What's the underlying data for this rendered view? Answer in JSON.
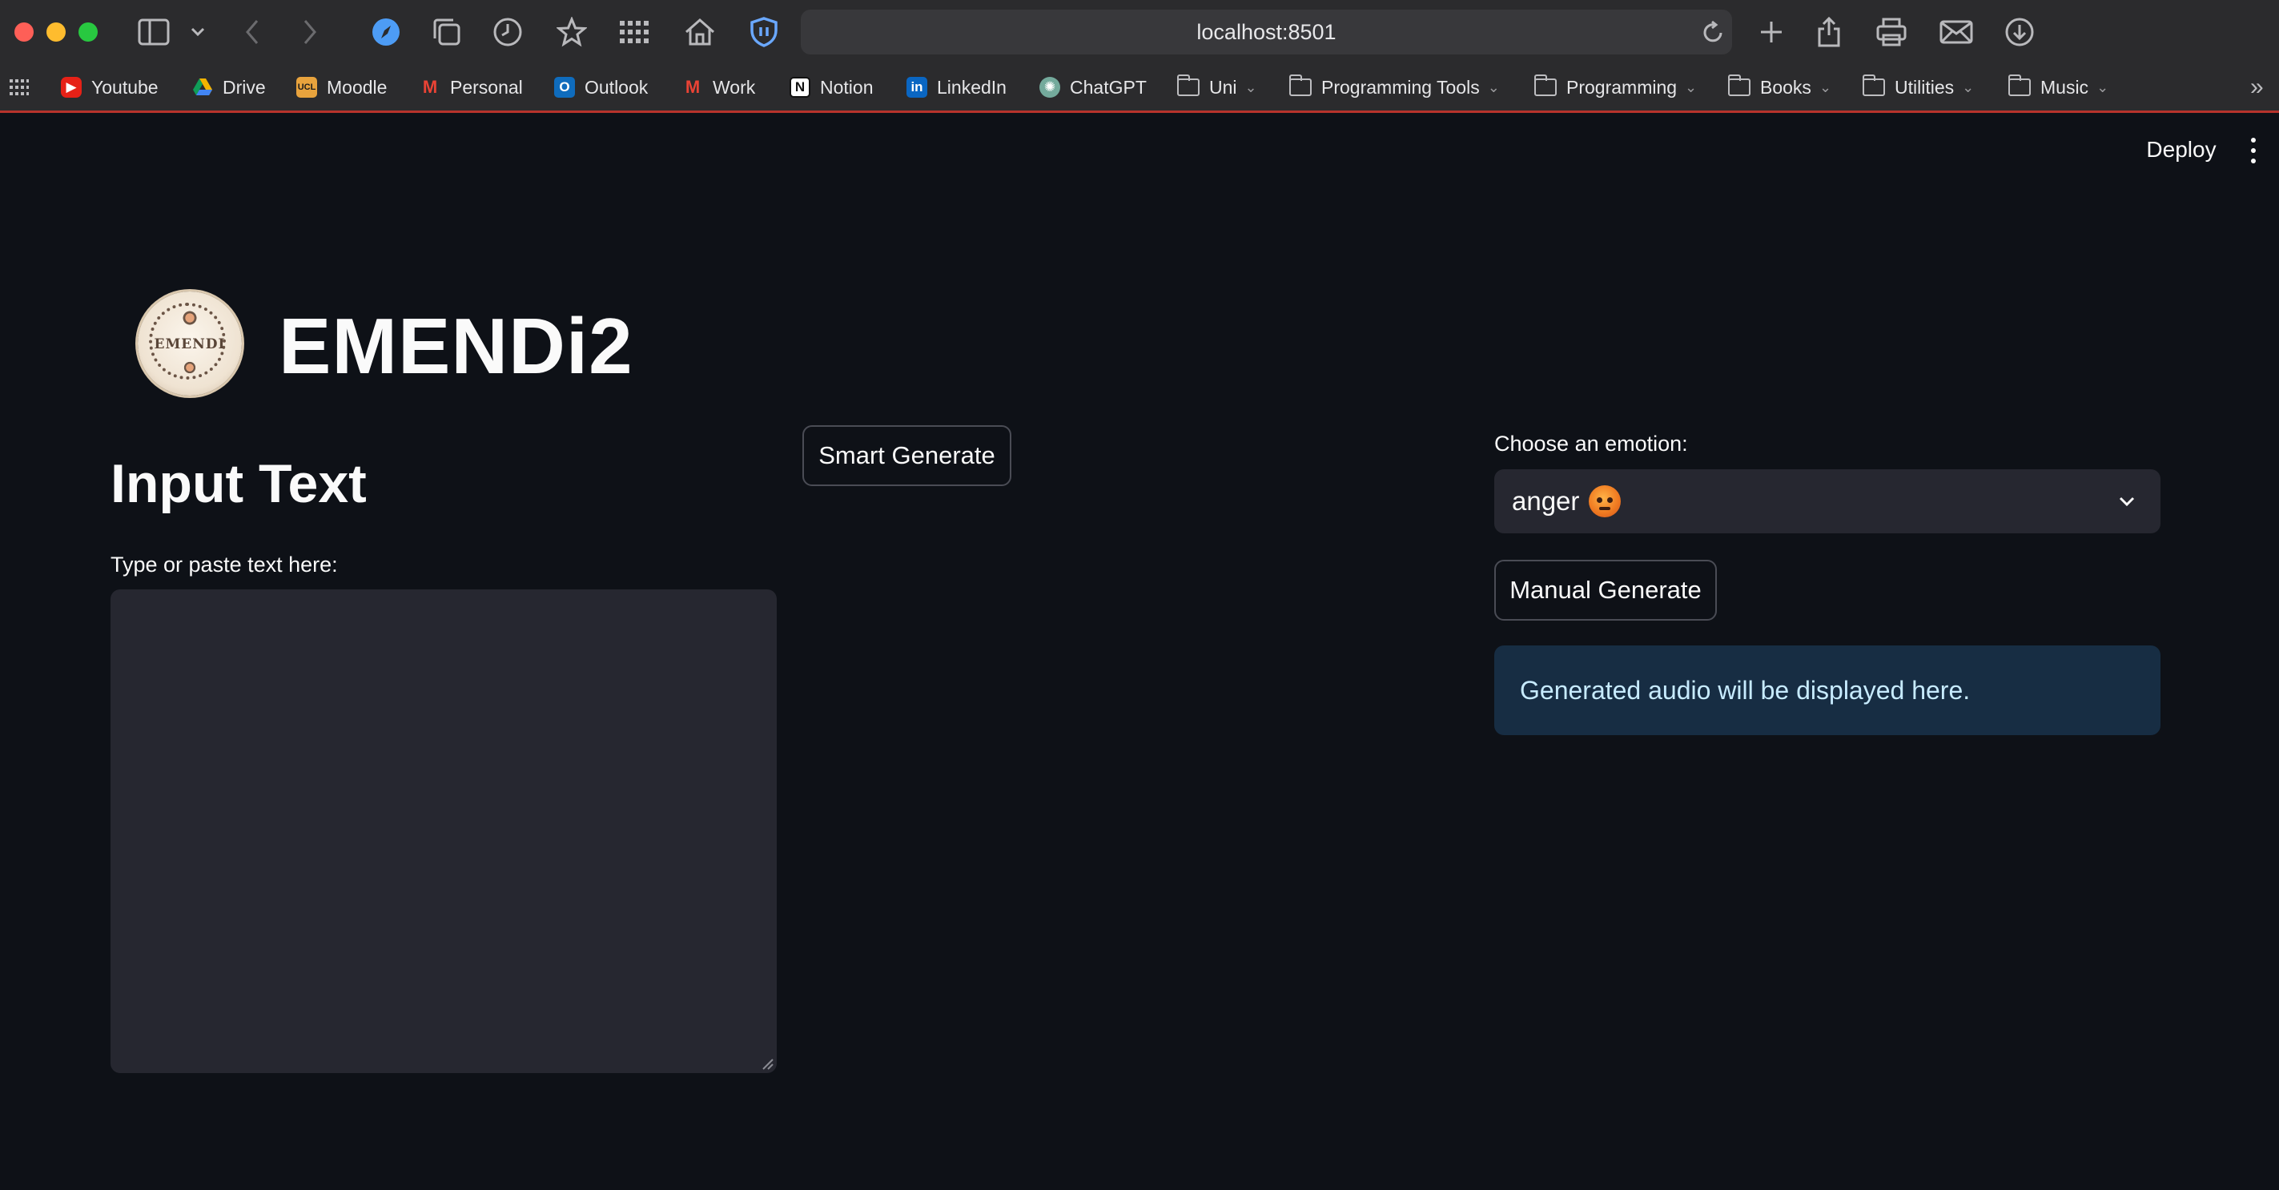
{
  "browser": {
    "url": "localhost:8501",
    "bookmarks": [
      {
        "label": "Youtube",
        "icon": "youtube-icon"
      },
      {
        "label": "Drive",
        "icon": "drive-icon"
      },
      {
        "label": "Moodle",
        "icon": "moodle-icon"
      },
      {
        "label": "Personal",
        "icon": "gmail-icon"
      },
      {
        "label": "Outlook",
        "icon": "outlook-icon"
      },
      {
        "label": "Work",
        "icon": "gmail-icon"
      },
      {
        "label": "Notion",
        "icon": "notion-icon"
      },
      {
        "label": "LinkedIn",
        "icon": "linkedin-icon"
      },
      {
        "label": "ChatGPT",
        "icon": "chatgpt-icon"
      },
      {
        "label": "Uni",
        "icon": "folder-icon"
      },
      {
        "label": "Programming Tools",
        "icon": "folder-icon"
      },
      {
        "label": "Programming",
        "icon": "folder-icon"
      },
      {
        "label": "Books",
        "icon": "folder-icon"
      },
      {
        "label": "Utilities",
        "icon": "folder-icon"
      },
      {
        "label": "Music",
        "icon": "folder-icon"
      }
    ]
  },
  "app": {
    "deploy_label": "Deploy",
    "logo_text": "EMENDI",
    "title": "EMENDi2",
    "input_header": "Input Text",
    "textarea_label": "Type or paste text here:",
    "textarea_value": "",
    "smart_generate_label": "Smart Generate",
    "emotion_label": "Choose an emotion:",
    "emotion_selected": "anger",
    "manual_generate_label": "Manual Generate",
    "info_message": "Generated audio will be displayed here."
  },
  "colors": {
    "background": "#0e1117",
    "widget_bg": "#262730",
    "info_bg": "#172d43",
    "info_text": "#c7ebff",
    "chrome_bg": "#2b2b2d"
  }
}
